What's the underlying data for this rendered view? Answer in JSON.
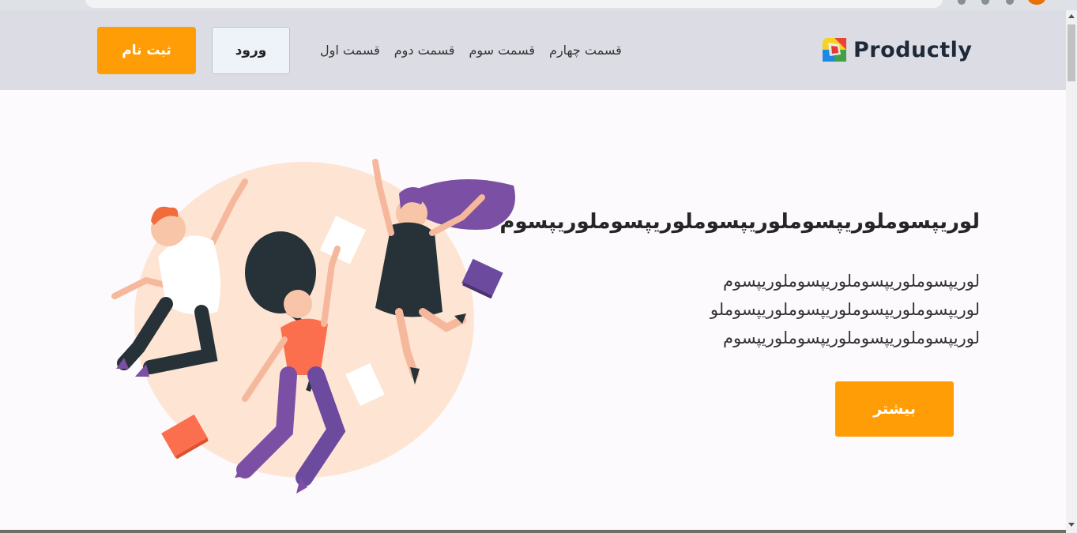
{
  "brand": {
    "name": "Productly",
    "logo": "productly-logo-icon"
  },
  "nav": {
    "links": [
      "قسمت اول",
      "قسمت دوم",
      "قسمت سوم",
      "قسمت چهارم"
    ],
    "login_label": "ورود",
    "signup_label": "ثبت نام"
  },
  "hero": {
    "title": "لوریپسوملوریپسوملوریپسوملوریپسوملوریپسوم",
    "lines": [
      "لوریپسوملوریپسوملوریپسوملوریپسوم",
      "لوریپسوملوریپسوملوریپسوملوریپسوملو",
      "لوریپسوملوریپسوملوریپسوملوریپسوم"
    ],
    "button_label": "بیشتر",
    "illustration": "jumping-people-illustration"
  },
  "colors": {
    "accent": "#ff9d06",
    "navbar_bg": "#dcdde4",
    "page_bg": "#fcfafc",
    "brand_text": "#1e2a3a",
    "blob": "#fde4d3"
  }
}
